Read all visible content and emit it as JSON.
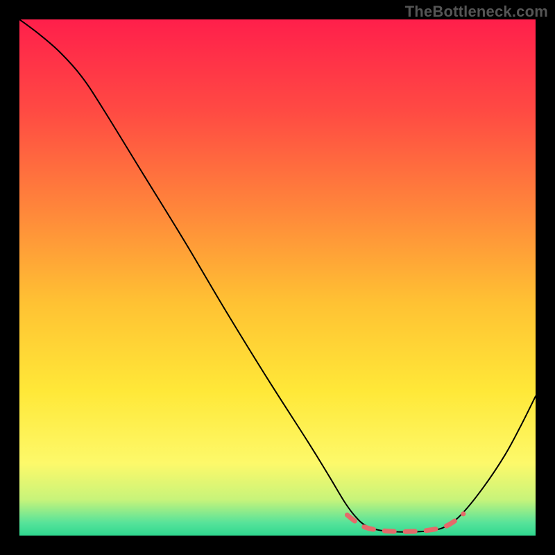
{
  "watermark": "TheBottleneck.com",
  "chart_data": {
    "type": "line",
    "title": "",
    "xlabel": "",
    "ylabel": "",
    "xlim": [
      0,
      100
    ],
    "ylim": [
      0,
      100
    ],
    "grid": false,
    "legend": false,
    "gradient_stops": [
      {
        "offset": 0.0,
        "color": "#ff1f4b"
      },
      {
        "offset": 0.18,
        "color": "#ff4b43"
      },
      {
        "offset": 0.38,
        "color": "#ff8a3a"
      },
      {
        "offset": 0.55,
        "color": "#ffc233"
      },
      {
        "offset": 0.72,
        "color": "#ffe838"
      },
      {
        "offset": 0.86,
        "color": "#fdf96a"
      },
      {
        "offset": 0.93,
        "color": "#c8f47a"
      },
      {
        "offset": 0.975,
        "color": "#57e39a"
      },
      {
        "offset": 1.0,
        "color": "#2fd88f"
      }
    ],
    "series": [
      {
        "name": "bottleneck-curve",
        "stroke": "#000000",
        "stroke_width": 2,
        "points": [
          {
            "x": 0.0,
            "y": 100.0
          },
          {
            "x": 4.0,
            "y": 97.0
          },
          {
            "x": 8.0,
            "y": 93.5
          },
          {
            "x": 12.0,
            "y": 89.0
          },
          {
            "x": 16.0,
            "y": 83.0
          },
          {
            "x": 24.0,
            "y": 70.0
          },
          {
            "x": 32.0,
            "y": 57.0
          },
          {
            "x": 40.0,
            "y": 43.5
          },
          {
            "x": 48.0,
            "y": 30.5
          },
          {
            "x": 56.0,
            "y": 18.0
          },
          {
            "x": 60.0,
            "y": 11.5
          },
          {
            "x": 63.0,
            "y": 6.5
          },
          {
            "x": 65.0,
            "y": 3.8
          },
          {
            "x": 67.0,
            "y": 2.0
          },
          {
            "x": 70.0,
            "y": 1.0
          },
          {
            "x": 75.0,
            "y": 0.7
          },
          {
            "x": 80.0,
            "y": 1.0
          },
          {
            "x": 83.0,
            "y": 2.0
          },
          {
            "x": 86.0,
            "y": 4.5
          },
          {
            "x": 90.0,
            "y": 9.5
          },
          {
            "x": 94.0,
            "y": 15.5
          },
          {
            "x": 97.0,
            "y": 21.0
          },
          {
            "x": 100.0,
            "y": 27.0
          }
        ]
      },
      {
        "name": "highlighted-bottom-dashes",
        "stroke": "#e46a6a",
        "stroke_width": 7,
        "style": "dashed",
        "points": [
          {
            "x": 63.5,
            "y": 4.0
          },
          {
            "x": 65.0,
            "y": 2.8
          },
          {
            "x": 67.0,
            "y": 1.6
          },
          {
            "x": 70.0,
            "y": 1.0
          },
          {
            "x": 73.0,
            "y": 0.8
          },
          {
            "x": 76.0,
            "y": 0.8
          },
          {
            "x": 79.0,
            "y": 1.0
          },
          {
            "x": 82.0,
            "y": 1.6
          },
          {
            "x": 84.0,
            "y": 2.6
          },
          {
            "x": 86.0,
            "y": 4.2
          }
        ]
      }
    ]
  }
}
